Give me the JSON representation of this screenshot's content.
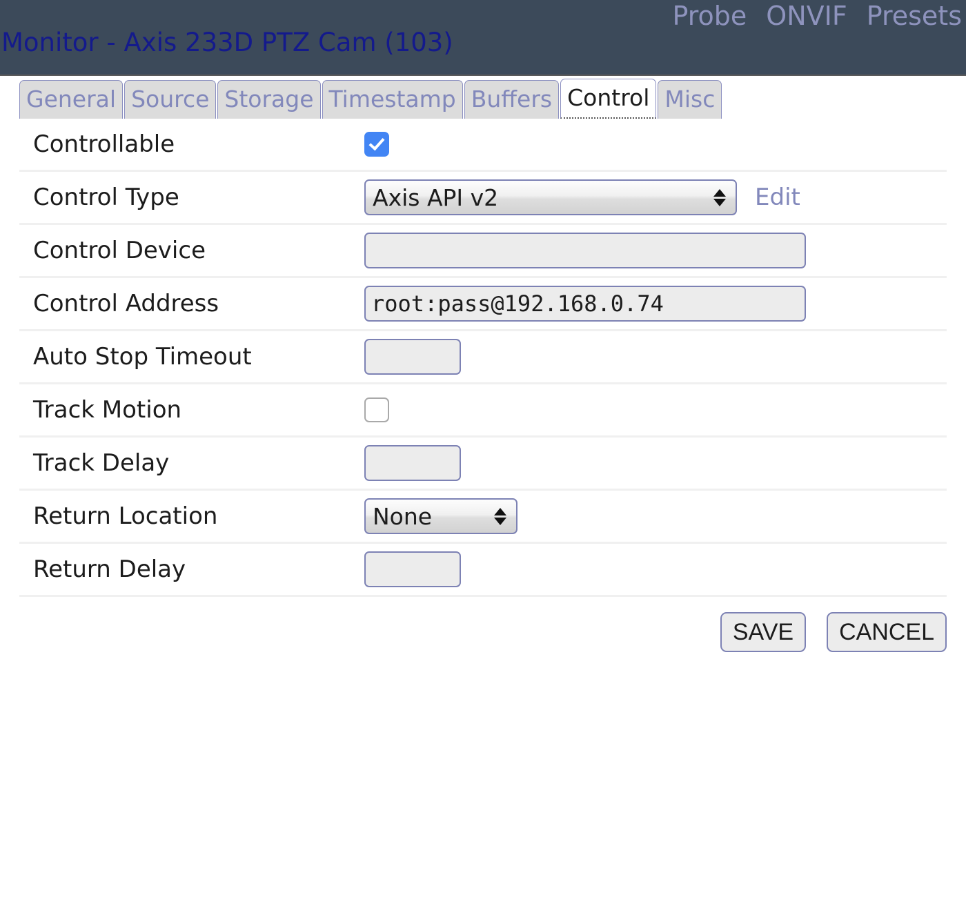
{
  "header": {
    "title": "Monitor - Axis 233D PTZ Cam (103)",
    "nav": [
      {
        "label": "Probe",
        "name": "nav-link-probe"
      },
      {
        "label": "ONVIF",
        "name": "nav-link-onvif"
      },
      {
        "label": "Presets",
        "name": "nav-link-presets"
      }
    ],
    "bg_color": "#3c4a5a",
    "title_color": "#141a8c",
    "link_color": "#8e93bd"
  },
  "tabs": [
    {
      "label": "General",
      "active": false
    },
    {
      "label": "Source",
      "active": false
    },
    {
      "label": "Storage",
      "active": false
    },
    {
      "label": "Timestamp",
      "active": false
    },
    {
      "label": "Buffers",
      "active": false
    },
    {
      "label": "Control",
      "active": true
    },
    {
      "label": "Misc",
      "active": false
    }
  ],
  "form": {
    "controllable": {
      "label": "Controllable",
      "checked": true
    },
    "control_type": {
      "label": "Control Type",
      "value": "Axis API v2",
      "edit_label": "Edit"
    },
    "control_device": {
      "label": "Control Device",
      "value": "",
      "placeholder": ""
    },
    "control_address": {
      "label": "Control Address",
      "value": "root:pass@192.168.0.74",
      "placeholder": ""
    },
    "auto_stop_timeout": {
      "label": "Auto Stop Timeout",
      "value": "",
      "placeholder": ""
    },
    "track_motion": {
      "label": "Track Motion",
      "checked": false
    },
    "track_delay": {
      "label": "Track Delay",
      "value": "",
      "placeholder": ""
    },
    "return_location": {
      "label": "Return Location",
      "value": "None"
    },
    "return_delay": {
      "label": "Return Delay",
      "value": "",
      "placeholder": ""
    }
  },
  "actions": {
    "save_label": "SAVE",
    "cancel_label": "CANCEL"
  }
}
